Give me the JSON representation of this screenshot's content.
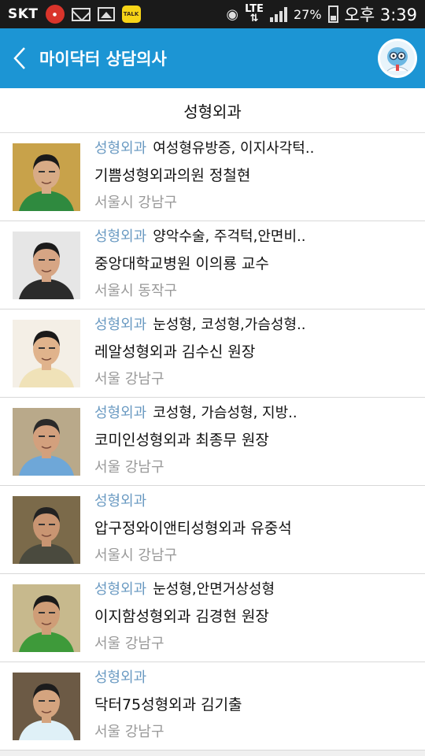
{
  "status_bar": {
    "carrier": "SKT",
    "network": "LTE",
    "battery": "27%",
    "time": "오후 3:39"
  },
  "app_bar": {
    "title": "마이닥터 상담의사"
  },
  "subheader": "성형외과",
  "doctors": [
    {
      "dept": "성형외과",
      "tags": "여성형유방증, 이지사각턱..",
      "name": "기쁨성형외과의원 정철현",
      "location": "서울시 강남구",
      "bg": "#c8a24a",
      "skin": "#d8ab86",
      "cloth": "#2f8a3f",
      "hair": "#1a1a1a"
    },
    {
      "dept": "성형외과",
      "tags": "양악수술, 주걱턱,안면비..",
      "name": "중앙대학교병원 이의룡 교수",
      "location": "서울시 동작구",
      "bg": "#e6e6e6",
      "skin": "#d6a584",
      "cloth": "#2b2b2b",
      "hair": "#1b1b1b"
    },
    {
      "dept": "성형외과",
      "tags": "눈성형, 코성형,가슴성형..",
      "name": "레알성형외과 김수신 원장",
      "location": "서울 강남구",
      "bg": "#f4efe6",
      "skin": "#e0b38c",
      "cloth": "#f0e2b8",
      "hair": "#1a1a1a"
    },
    {
      "dept": "성형외과",
      "tags": "코성형, 가슴성형, 지방..",
      "name": "코미인성형외과 최종무 원장",
      "location": "서울 강남구",
      "bg": "#b9a98a",
      "skin": "#d3a07d",
      "cloth": "#6ea7d8",
      "hair": "#2a2a2a"
    },
    {
      "dept": "성형외과",
      "tags": "",
      "name": "압구정와이앤티성형외과 유중석",
      "location": "서울시 강남구",
      "bg": "#7b6a4a",
      "skin": "#c99572",
      "cloth": "#4a4a3e",
      "hair": "#222"
    },
    {
      "dept": "성형외과",
      "tags": "눈성형,안면거상성형",
      "name": "이지함성형외과 김경현 원장",
      "location": "서울 강남구",
      "bg": "#c7b98d",
      "skin": "#cf9d77",
      "cloth": "#3e9a3a",
      "hair": "#1a1a1a"
    },
    {
      "dept": "성형외과",
      "tags": "",
      "name": "닥터75성형외과 김기출",
      "location": "서울 강남구",
      "bg": "#6c5a45",
      "skin": "#d4a47f",
      "cloth": "#dff0f7",
      "hair": "#1c1c1c"
    }
  ]
}
